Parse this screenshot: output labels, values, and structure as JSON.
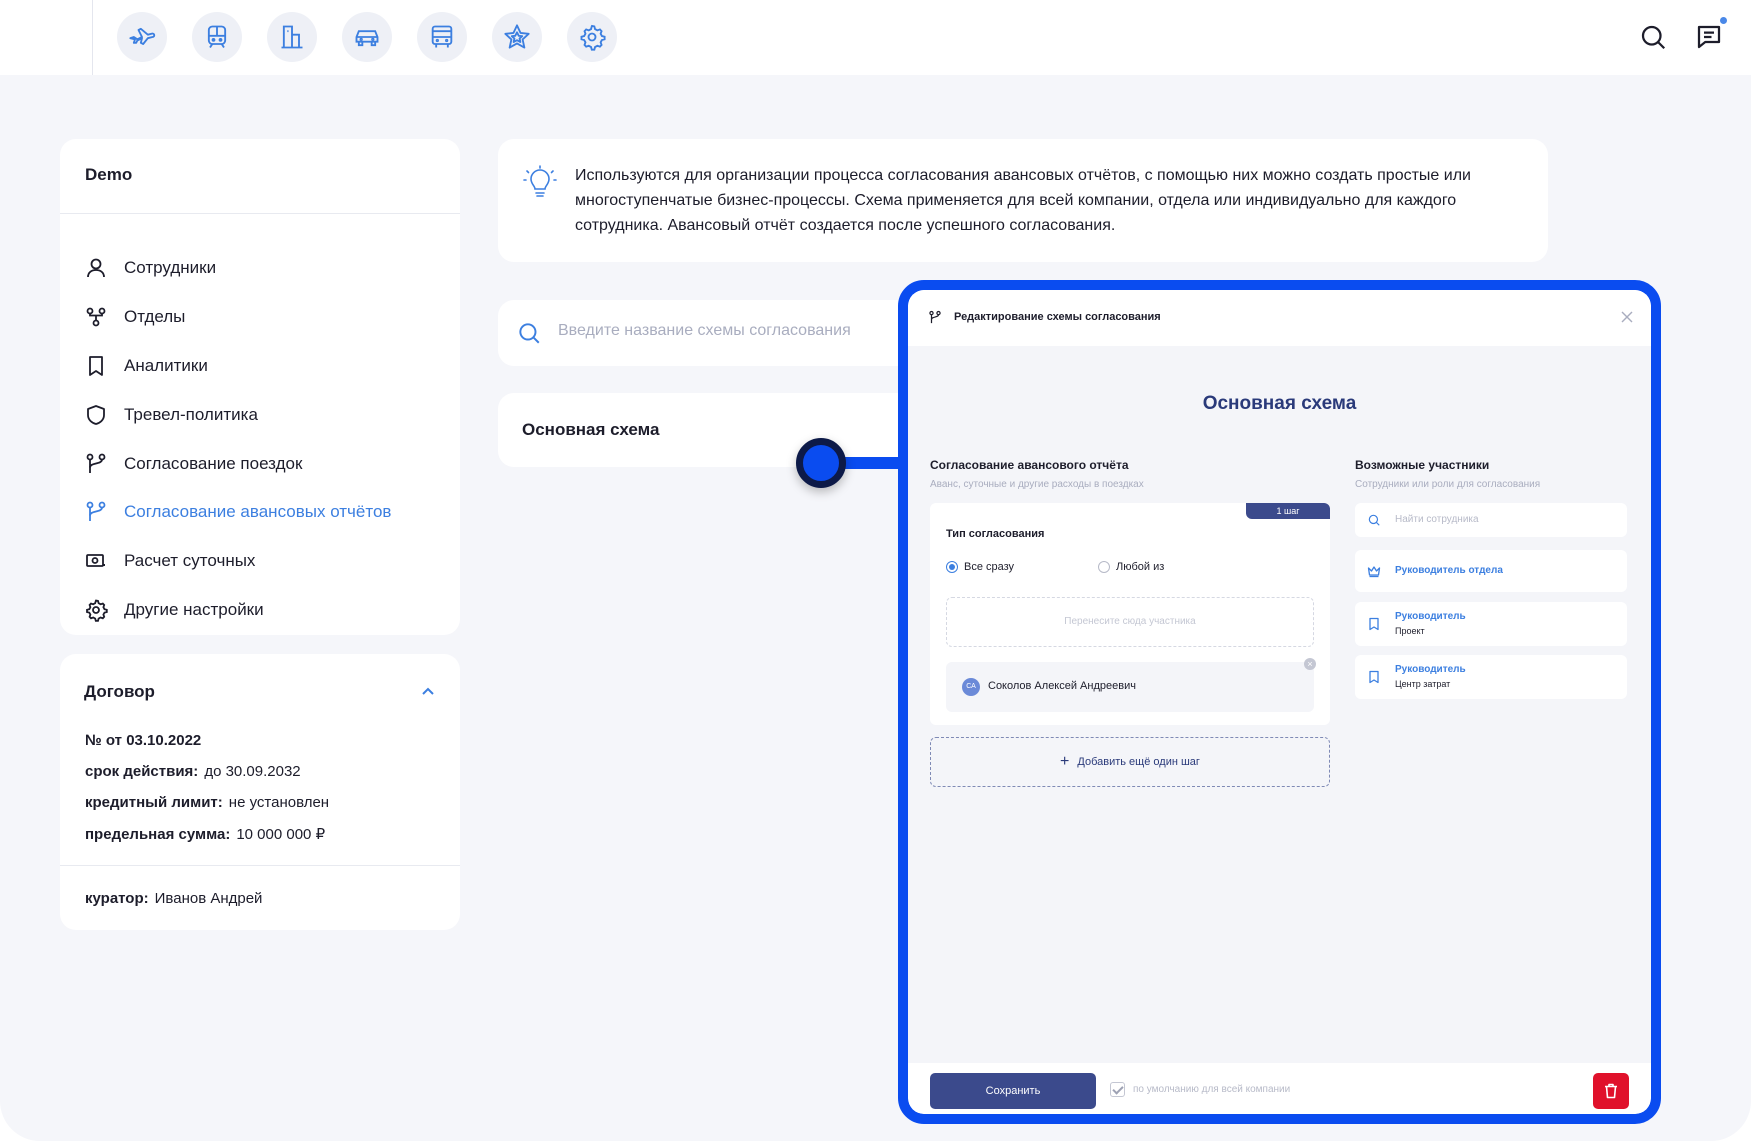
{
  "topbar": {
    "services": [
      {
        "icon": "airplane-icon"
      },
      {
        "icon": "train-icon"
      },
      {
        "icon": "hotel-icon"
      },
      {
        "icon": "car-icon"
      },
      {
        "icon": "bus-icon"
      },
      {
        "icon": "star-icon"
      },
      {
        "icon": "gear-icon"
      }
    ],
    "right_icons": [
      "search-icon",
      "chat-icon"
    ]
  },
  "company": {
    "name": "Demo",
    "nav": [
      {
        "label": "Сотрудники",
        "icon": "user-icon"
      },
      {
        "label": "Отделы",
        "icon": "departments-icon"
      },
      {
        "label": "Аналитики",
        "icon": "bookmark-icon"
      },
      {
        "label": "Тревел-политика",
        "icon": "shield-icon"
      },
      {
        "label": "Согласование поездок",
        "icon": "branch-icon"
      },
      {
        "label": "Согласование авансовых отчётов",
        "icon": "branch-icon",
        "active": true
      },
      {
        "label": "Расчет суточных",
        "icon": "money-icon"
      },
      {
        "label": "Другие настройки",
        "icon": "gear-icon"
      }
    ]
  },
  "contract": {
    "title": "Договор",
    "number": "№ от 03.10.2022",
    "validity_label": "срок действия:",
    "validity_value": "до 30.09.2032",
    "credit_label": "кредитный лимит:",
    "credit_value": "не установлен",
    "limit_label": "предельная сумма:",
    "limit_value": "10 000 000 ₽",
    "curator_label": "куратор:",
    "curator_value": "Иванов Андрей"
  },
  "info": {
    "text": "Используются для организации процесса согласования авансовых отчётов, с помощью них можно создать простые или многоступенчатые бизнес-процессы. Схема применяется для всей компании, отдела или индивидуально для каждого сотрудника. Авансовый отчёт создается после успешного согласования."
  },
  "search": {
    "placeholder": "Введите название схемы согласования"
  },
  "schemes": [
    {
      "name": "Основная схема"
    }
  ],
  "modal": {
    "header": "Редактирование схемы согласования",
    "title": "Основная схема",
    "left_title": "Согласование авансового отчёта",
    "left_subtitle": "Аванс, суточные и другие расходы в поездках",
    "step_badge": "1 шаг",
    "approval_type_label": "Тип согласования",
    "radio_all": "Все сразу",
    "radio_any": "Любой из",
    "dropzone": "Перенесите сюда участника",
    "participant_initials": "СА",
    "participant_name": "Соколов Алексей Андреевич",
    "add_step": "Добавить ещё один шаг",
    "right_title": "Возможные участники",
    "right_subtitle": "Сотрудники или роли для согласования",
    "participant_search_placeholder": "Найти сотрудника",
    "roles": [
      {
        "name": "Руководитель отдела",
        "sub": ""
      },
      {
        "name": "Руководитель",
        "sub": "Проект"
      },
      {
        "name": "Руководитель",
        "sub": "Центр затрат"
      }
    ],
    "save_label": "Сохранить",
    "default_label": "по умолчанию для всей компании",
    "default_checked": true
  },
  "colors": {
    "accent": "#3c7fe0",
    "primary_dark": "#3b4a8c",
    "highlight": "#0a4cf0",
    "danger": "#e0112b"
  }
}
